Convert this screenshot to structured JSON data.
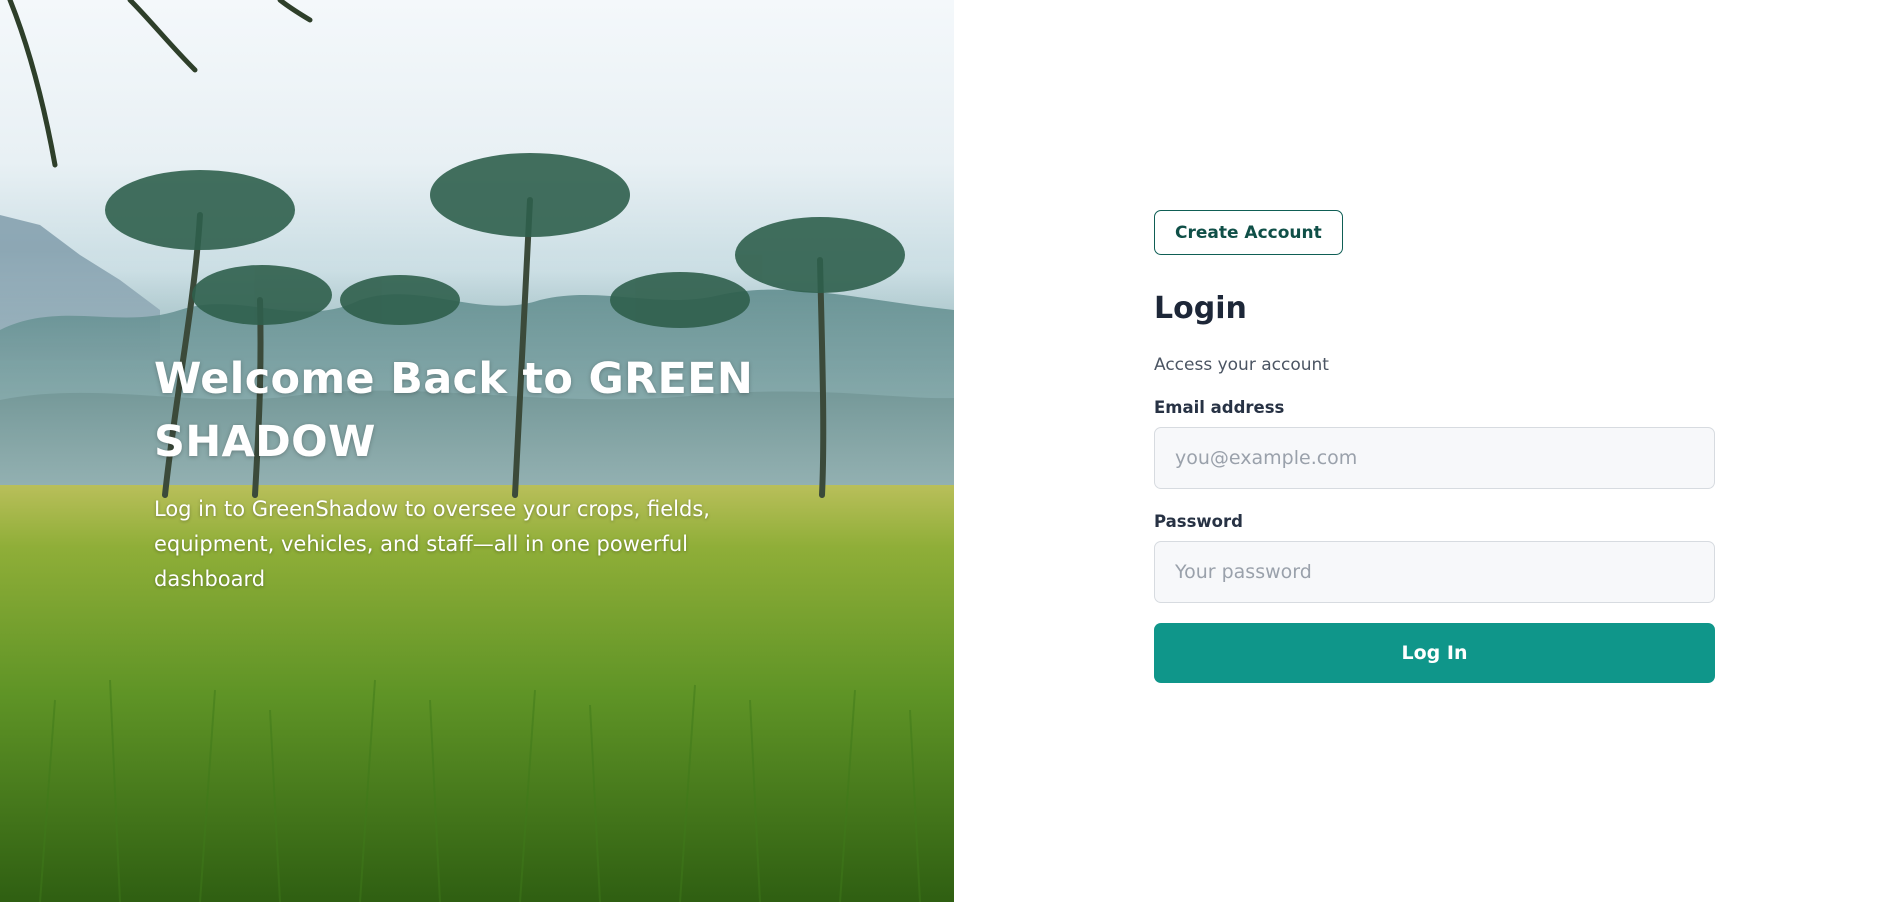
{
  "hero": {
    "title_line1": "Welcome Back to GREEN",
    "title_line2": "SHADOW",
    "subtitle_line1": "Log in to GreenShadow to oversee your crops, fields,",
    "subtitle_line2": "equipment, vehicles, and staff—all in one powerful dashboard"
  },
  "login": {
    "create_account_label": "Create Account",
    "title": "Login",
    "subtitle": "Access your account",
    "email_label": "Email address",
    "email_placeholder": "you@example.com",
    "email_value": "",
    "password_label": "Password",
    "password_placeholder": "Your password",
    "password_value": "",
    "submit_label": "Log In"
  },
  "colors": {
    "accent": "#0f968a",
    "outline_button": "#0f5e55",
    "heading": "#1d2738"
  }
}
